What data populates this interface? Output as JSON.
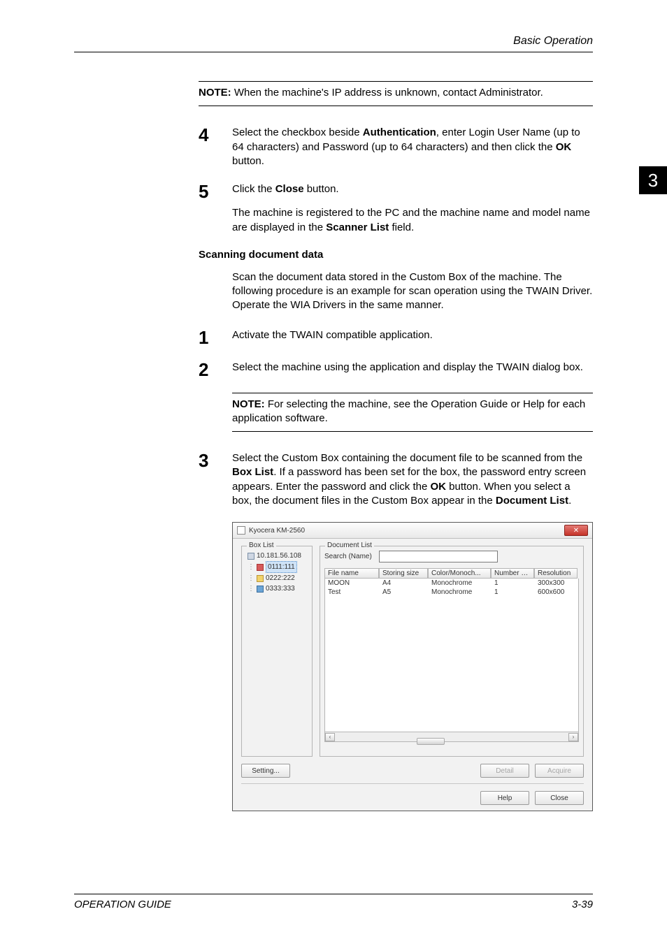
{
  "header": {
    "section_title": "Basic Operation"
  },
  "tab": {
    "label": "3"
  },
  "note1": {
    "label": "NOTE:",
    "text": " When the machine's IP address is unknown, contact Administrator."
  },
  "step4": {
    "num": "4",
    "text_a": "Select the checkbox beside ",
    "bold_a": "Authentication",
    "text_b": ", enter Login User Name (up to 64 characters) and Password (up to 64 characters) and then click the ",
    "bold_b": "OK",
    "text_c": " button."
  },
  "step5": {
    "num": "5",
    "line1_a": "Click the ",
    "line1_bold": "Close",
    "line1_b": " button.",
    "line2_a": "The machine is registered to the PC and the machine name and model name are displayed in the ",
    "line2_bold": "Scanner List",
    "line2_b": " field."
  },
  "sectionB": {
    "heading": "Scanning document data",
    "intro": "Scan the document data stored in the Custom Box of the machine. The following procedure is an example for scan operation using the TWAIN Driver. Operate the WIA Drivers in the same manner."
  },
  "stepB1": {
    "num": "1",
    "text": "Activate the TWAIN compatible application."
  },
  "stepB2": {
    "num": "2",
    "text": "Select the machine using the application and display the TWAIN dialog box."
  },
  "note2": {
    "label": "NOTE:",
    "text": " For selecting the machine, see the Operation Guide or Help for each application software."
  },
  "stepB3": {
    "num": "3",
    "a": "Select the Custom Box containing the document file to be scanned from the ",
    "b1": "Box List",
    "c": ". If a password has been set for the box, the password entry screen appears. Enter the password and click the ",
    "b2": "OK",
    "d": " button. When you select a box, the document files in the Custom Box appear in the ",
    "b3": "Document List",
    "e": "."
  },
  "dialog": {
    "title": "Kyocera KM-2560",
    "close_glyph": "✕",
    "box_list_legend": "Box List",
    "doc_list_legend": "Document List",
    "search_label": "Search (Name)",
    "tree": {
      "root": "10.181.56.108",
      "n1": "0111:111",
      "n2": "0222:222",
      "n3": "0333:333"
    },
    "columns": [
      "File name",
      "Storing size",
      "Color/Monoch...",
      "Number of...",
      "Resolution"
    ],
    "rows": [
      {
        "c0": "MOON",
        "c1": "A4",
        "c2": "Monochrome",
        "c3": "1",
        "c4": "300x300"
      },
      {
        "c0": "Test",
        "c1": "A5",
        "c2": "Monochrome",
        "c3": "1",
        "c4": "600x600"
      }
    ],
    "scroll_left": "‹",
    "scroll_right": "›",
    "buttons": {
      "setting": "Setting...",
      "detail": "Detail",
      "acquire": "Acquire",
      "help": "Help",
      "close": "Close"
    }
  },
  "footer": {
    "left": "OPERATION GUIDE",
    "right": "3-39"
  }
}
